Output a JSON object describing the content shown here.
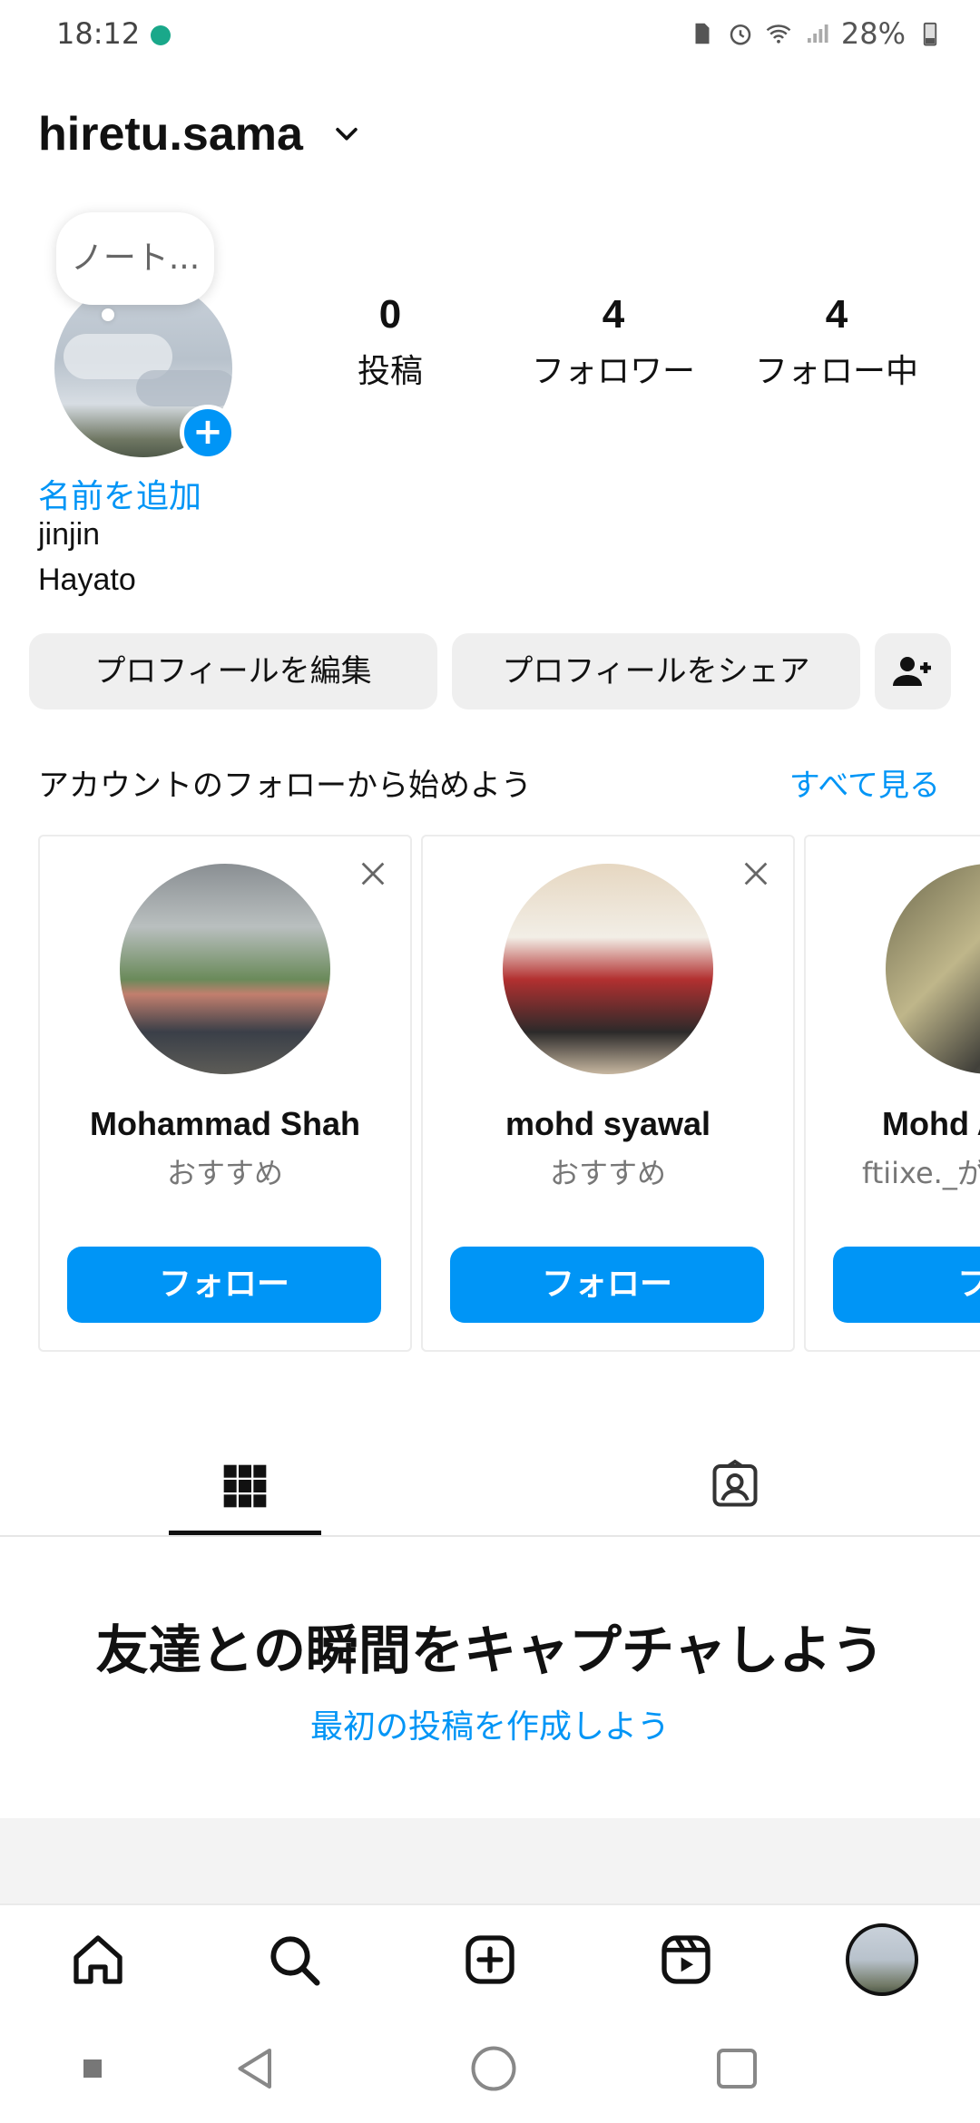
{
  "status_bar": {
    "time": "18:12",
    "battery": "28%"
  },
  "header": {
    "username": "hiretu.sama"
  },
  "profile": {
    "note": "ノート...",
    "stats": [
      {
        "value": "0",
        "label": "投稿"
      },
      {
        "value": "4",
        "label": "フォロワー"
      },
      {
        "value": "4",
        "label": "フォロー中"
      }
    ],
    "add_name": "名前を追加",
    "bio_line1": "jinjin",
    "bio_line2": "Hayato"
  },
  "buttons": {
    "edit_profile": "プロフィールを編集",
    "share_profile": "プロフィールをシェア"
  },
  "suggested": {
    "title": "アカウントのフォローから始めよう",
    "see_all": "すべて見る",
    "cards": [
      {
        "name": "Mohammad Shah",
        "sub": "おすすめ",
        "follow": "フォロー"
      },
      {
        "name": "mohd syawal",
        "sub": "おすすめ",
        "follow": "フォロー"
      },
      {
        "name": "Mohd A",
        "sub": "ftiixe._がフ",
        "follow": "フォ"
      }
    ]
  },
  "empty_state": {
    "title": "友達との瞬間をキャプチャしよう",
    "link": "最初の投稿を作成しよう"
  },
  "icons": {
    "status": [
      "message-icon",
      "sim-icon",
      "alarm-icon",
      "wifi-icon",
      "signal-icon",
      "battery-icon"
    ],
    "tabs": [
      "grid-icon",
      "tagged-icon"
    ],
    "bottom_nav": [
      "home-icon",
      "search-icon",
      "create-icon",
      "reels-icon",
      "profile-icon"
    ],
    "system_nav": [
      "recent-dot-icon",
      "back-icon",
      "home-circle-icon",
      "overview-icon"
    ]
  },
  "colors": {
    "accent": "#0095f6",
    "button_bg": "#efefef",
    "text": "#111111"
  }
}
